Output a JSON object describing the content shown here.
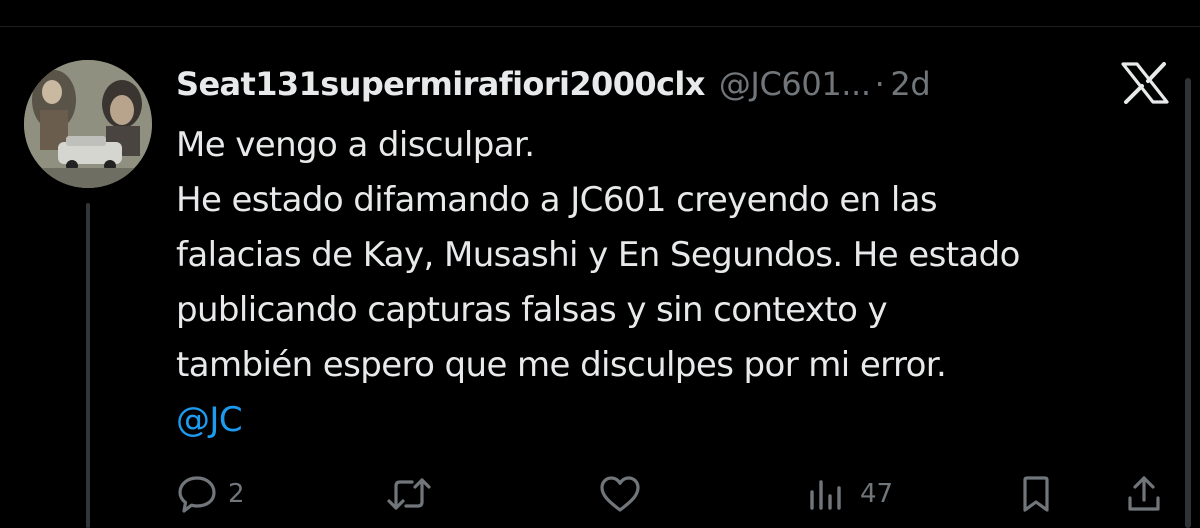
{
  "tweet": {
    "display_name": "Seat131supermirafiori2000clx",
    "handle": "@JC601...",
    "separator": "·",
    "time": "2d",
    "lines": [
      "Me vengo a disculpar.",
      "He estado difamando a JC601 creyendo en las",
      "falacias de Kay, Musashi y En Segundos. He estado",
      "publicando capturas falsas y sin contexto y",
      "también espero que me disculpes por mi error."
    ],
    "mention": "@JC"
  },
  "actions": {
    "reply": {
      "icon": "reply-icon",
      "count": "2"
    },
    "retweet": {
      "icon": "retweet-icon"
    },
    "like": {
      "icon": "heart-icon"
    },
    "views": {
      "icon": "views-chart-icon",
      "count": "47"
    },
    "bookmark": {
      "icon": "bookmark-icon"
    },
    "share": {
      "icon": "share-icon"
    }
  },
  "colors": {
    "background": "#000000",
    "text": "#e7e9ea",
    "muted": "#71767b",
    "accent": "#1d9bf0"
  }
}
